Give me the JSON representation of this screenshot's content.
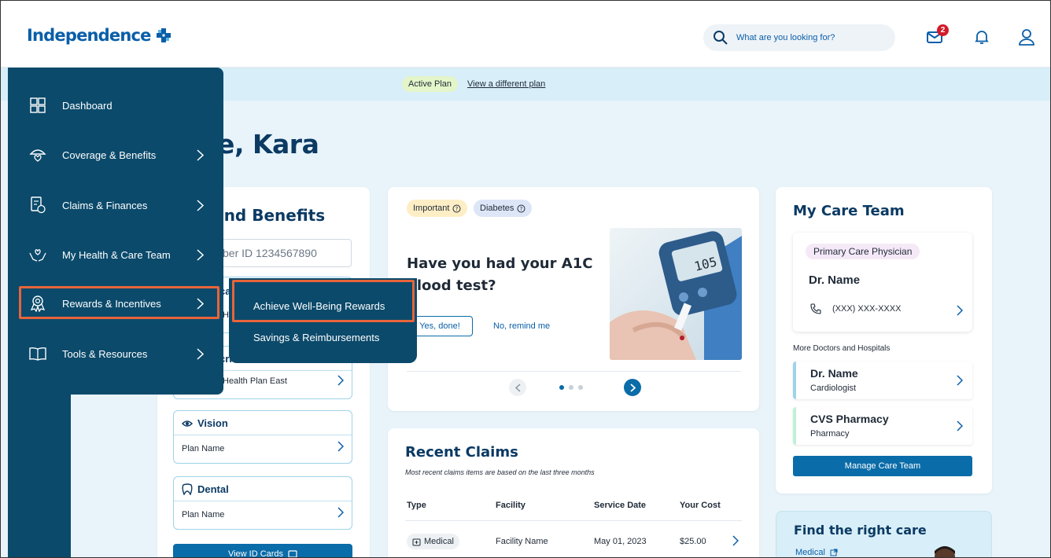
{
  "header": {
    "logo_text": "Independence",
    "search_placeholder": "What are you looking for?",
    "mail_badge_count": "2"
  },
  "plan_bar": {
    "active_plan_label": "Active Plan",
    "view_plan_link": "View a different plan"
  },
  "welcome": "ome, Kara",
  "sidebar": {
    "items": [
      {
        "label": "Dashboard",
        "icon": "dashboard-grid-icon"
      },
      {
        "label": "Coverage & Benefits",
        "icon": "umbrella-heart-icon"
      },
      {
        "label": "Claims & Finances",
        "icon": "document-dollar-icon"
      },
      {
        "label": "My Health & Care Team",
        "icon": "hands-heart-icon"
      },
      {
        "label": "Rewards & Incentives",
        "icon": "award-ribbon-icon"
      },
      {
        "label": "Tools & Resources",
        "icon": "open-book-icon"
      }
    ],
    "submenu": [
      "Achieve Well-Being Rewards",
      "Savings & Reimbursements"
    ]
  },
  "plan_benefits": {
    "title": "n and Benefits",
    "member_id": "ber ID 1234567890",
    "medical_fragment_1": "ca",
    "medical_fragment_2": "He",
    "rx_fragment": "cri",
    "rx_plan": "Health Plan East",
    "vision_title": "Vision",
    "vision_plan": "Plan Name",
    "dental_title": "Dental",
    "dental_plan": "Plan Name",
    "id_cards_button": "View ID Cards"
  },
  "a1c_card": {
    "tags": [
      "Important",
      "Diabetes"
    ],
    "title": "Have you had your A1C blood test?",
    "yes_button": "Yes, done!",
    "remind_link": "No, remind me",
    "meter_reading": "105"
  },
  "recent_claims": {
    "title": "Recent Claims",
    "subtitle": "Most recent claims items are based on the last three months",
    "headers": [
      "Type",
      "Facility",
      "Service Date",
      "Your Cost"
    ],
    "rows": [
      {
        "type": "Medical",
        "facility": "Facility Name",
        "date": "May 01, 2023",
        "cost": "$25.00"
      }
    ]
  },
  "care_team": {
    "title": "My Care Team",
    "pcp_label": "Primary Care Physician",
    "pcp_name": "Dr. Name",
    "phone": "(XXX) XXX-XXXX",
    "more_label": "More Doctors and Hospitals",
    "others": [
      {
        "name": "Dr. Name",
        "sub": "Cardiologist",
        "color": "#9fd3ea"
      },
      {
        "name": "CVS Pharmacy",
        "sub": "Pharmacy",
        "color": "#bff0d9"
      }
    ],
    "manage_button": "Manage Care Team"
  },
  "find_care": {
    "title": "Find the right care",
    "link": "Medical"
  },
  "colors": {
    "primary": "#0a6ca8",
    "navy": "#0b4a6b",
    "highlight": "#e8643a",
    "badge": "#d11a2a"
  }
}
